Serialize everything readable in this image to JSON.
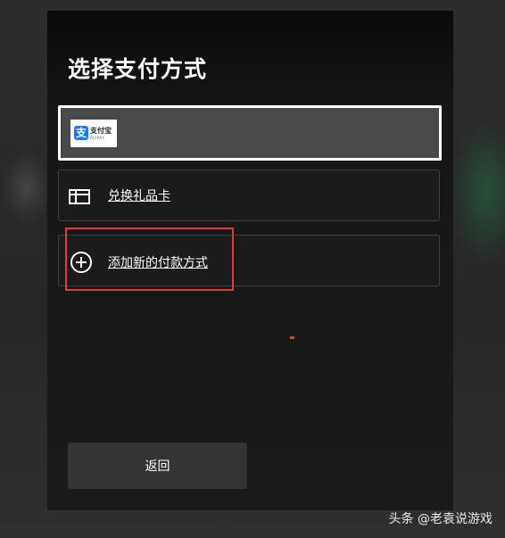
{
  "dialog": {
    "title": "选择支付方式"
  },
  "payment_options": [
    {
      "id": "alipay",
      "selected": true,
      "logo_text": "支付宝",
      "logo_subtext": "ALIPAY",
      "icon": "alipay-logo"
    },
    {
      "id": "gift-card",
      "selected": false,
      "label": "兑换礼品卡",
      "icon": "gift-card-icon"
    },
    {
      "id": "add-new",
      "selected": false,
      "label": "添加新的付款方式",
      "icon": "plus-circle-icon"
    }
  ],
  "actions": {
    "back_label": "返回"
  },
  "watermark": {
    "text": "头条 @老袁说游戏"
  },
  "colors": {
    "accent_highlight": "#e53935",
    "alipay_blue": "#1677ff",
    "panel_bg": "#1a1a1a",
    "selected_bg": "#4a4a4a"
  }
}
